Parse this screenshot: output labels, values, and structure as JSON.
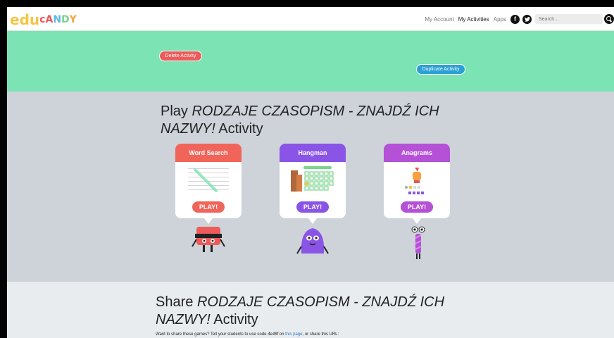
{
  "header": {
    "logo_letters": [
      {
        "ch": "e",
        "color": "#f5c542"
      },
      {
        "ch": "d",
        "color": "#f5c542"
      },
      {
        "ch": "u",
        "color": "#f5c542"
      },
      {
        "ch": "c",
        "color": "#e9555a"
      },
      {
        "ch": "A",
        "color": "#e9555a"
      },
      {
        "ch": "N",
        "color": "#5bb7e8"
      },
      {
        "ch": "D",
        "color": "#7bd38e"
      },
      {
        "ch": "Y",
        "color": "#f5a142"
      }
    ],
    "nav": {
      "my_account": "My Account",
      "my_activities": "My Activities",
      "apps": "Apps"
    },
    "facebook_glyph": "f",
    "search_placeholder": "Search..."
  },
  "band": {
    "delete_label": "Delete Activity",
    "duplicate_label": "Duplicate Activity"
  },
  "play": {
    "title_prefix": "Play ",
    "activity_name": "RODZAJE CZASOPISM - ZNAJDŹ ICH NAZWY!",
    "title_suffix": " Activity",
    "games": [
      {
        "name": "Word Search",
        "play": "PLAY!",
        "color": "#f0645a"
      },
      {
        "name": "Hangman",
        "play": "PLAY!",
        "color": "#8a55e6"
      },
      {
        "name": "Anagrams",
        "play": "PLAY!",
        "color": "#b451d6"
      }
    ]
  },
  "share": {
    "title_prefix": "Share ",
    "activity_name": "RODZAJE CZASOPISM - ZNAJDŹ ICH NAZWY!",
    "title_suffix": " Activity",
    "text_before": "Want to share these games? Tell your students to use code ",
    "code": "4e48f",
    "text_middle": " on ",
    "link": "this page",
    "text_after": ", or share this URL:"
  }
}
